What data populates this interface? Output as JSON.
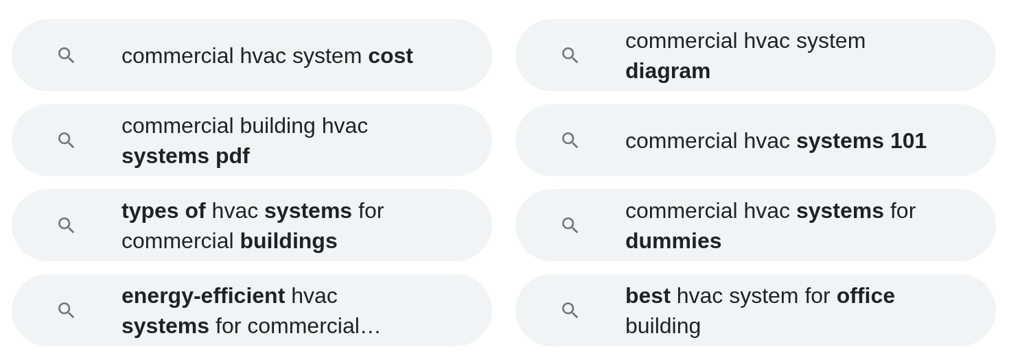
{
  "suggestions": [
    {
      "lines": [
        "commercial hvac system **cost**"
      ]
    },
    {
      "lines": [
        "commercial building hvac",
        "**systems pdf**"
      ]
    },
    {
      "lines": [
        "**types of** hvac **systems** for",
        "commercial **buildings**"
      ]
    },
    {
      "lines": [
        "**energy-efficient** hvac",
        "**systems** for commercial…"
      ]
    },
    {
      "lines": [
        "commercial hvac system",
        "**diagram**"
      ]
    },
    {
      "lines": [
        "commercial hvac **systems 101**"
      ]
    },
    {
      "lines": [
        "commercial hvac **systems** for",
        "**dummies**"
      ]
    },
    {
      "lines": [
        "**best** hvac system for **office**",
        "building"
      ]
    }
  ]
}
